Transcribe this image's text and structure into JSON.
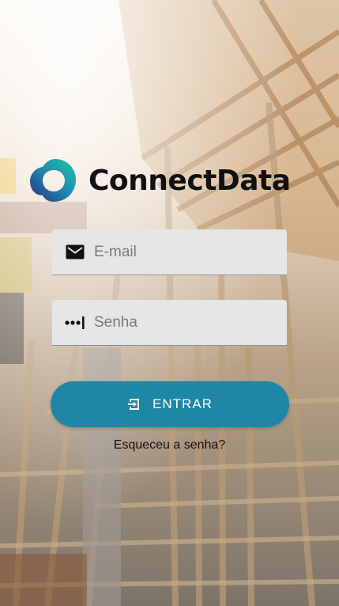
{
  "app": {
    "brand_name": "ConnectData"
  },
  "login": {
    "email_placeholder": "E-mail",
    "password_placeholder": "Senha",
    "submit_label": "ENTRAR",
    "forgot_label": "Esqueceu a senha?"
  },
  "icons": {
    "email": "mail-icon",
    "password": "password-dots-icon",
    "submit": "login-arrow-icon"
  },
  "colors": {
    "button": "#1f86a6",
    "logo_teal": "#1fb5a9",
    "logo_navy": "#27307f",
    "field_bg": "#e6e6e6"
  }
}
